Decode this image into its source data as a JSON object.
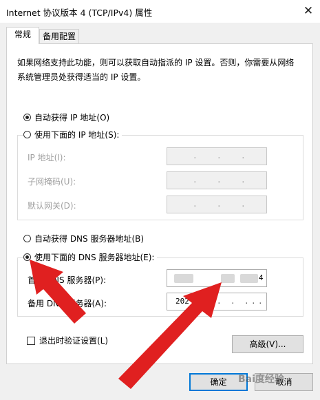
{
  "window": {
    "title": "Internet 协议版本 4 (TCP/IPv4) 属性",
    "close_glyph": "✕"
  },
  "tabs": [
    {
      "label": "常规",
      "active": true
    },
    {
      "label": "备用配置",
      "active": false
    }
  ],
  "description": "如果网络支持此功能，则可以获取自动指派的 IP 设置。否则，你需要从网络系统管理员处获得适当的 IP 设置。",
  "ip_section": {
    "auto_label": "自动获得 IP 地址(O)",
    "manual_label": "使用下面的 IP 地址(S):",
    "selected": "auto",
    "fields": [
      {
        "label": "IP 地址(I):",
        "value": "",
        "enabled": false
      },
      {
        "label": "子网掩码(U):",
        "value": "",
        "enabled": false
      },
      {
        "label": "默认网关(D):",
        "value": "",
        "enabled": false
      }
    ]
  },
  "dns_section": {
    "auto_label": "自动获得 DNS 服务器地址(B)",
    "manual_label": "使用下面的 DNS 服务器地址(E):",
    "selected": "manual",
    "preferred_label": "首选 DNS 服务器(P):",
    "alternate_label": "备用 DNS 服务器(A):",
    "preferred_value_visible": "4",
    "alternate_value_visible": "202"
  },
  "validate_checkbox": {
    "label": "退出时验证设置(L)",
    "checked": false
  },
  "buttons": {
    "advanced": "高级(V)...",
    "ok": "确定",
    "cancel": "取消"
  },
  "watermark": "Bai度经验",
  "colors": {
    "arrow": "#e02020",
    "default_button_border": "#0078d7",
    "dialog_bg": "#f0f0f0"
  }
}
